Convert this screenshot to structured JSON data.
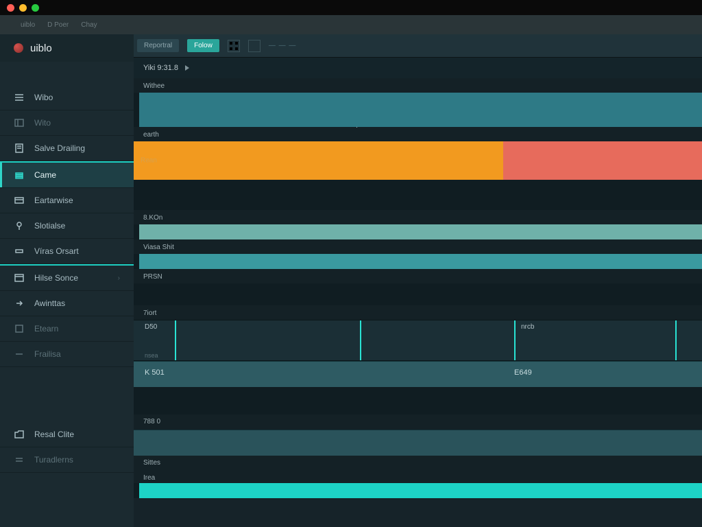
{
  "window": {
    "app_menu": "uiblo",
    "tab1": "D Poer",
    "tab2": "Chay"
  },
  "toolbar": {
    "btn1": "Reportral",
    "btn2": "Folow",
    "hint": "— — —"
  },
  "brand": {
    "name": "uiblo"
  },
  "sidebar": {
    "items": [
      {
        "label": "Wibo"
      },
      {
        "label": "Wito"
      },
      {
        "label": "Salve Drailing"
      },
      {
        "label": "Came"
      },
      {
        "label": "Eartarwise"
      },
      {
        "label": "Slotialse"
      },
      {
        "label": "Víras Orsart"
      },
      {
        "label": "Hilse Sonce"
      },
      {
        "label": "Awinttas"
      },
      {
        "label": "Etearn"
      },
      {
        "label": "Frailisa"
      }
    ],
    "bottom": [
      {
        "label": "Resal Clite"
      },
      {
        "label": "Turadlerns"
      }
    ]
  },
  "main": {
    "heading": "Yiki  9:31.8",
    "tracks": {
      "t1_label": "Withee",
      "t2_label": "earth",
      "t2_clip_label": "Rean",
      "t3_label": "8.KOn",
      "t4_label": "Viasa Shit",
      "t5_label": "PRSN"
    },
    "timeline": {
      "label": "7iort",
      "tick1": "D50",
      "tick2": "nrcb",
      "bottom1": "nsea"
    },
    "values": {
      "v1": "K 501",
      "v2": "E649"
    },
    "bottom_labels": {
      "l1": "788 0",
      "l2": "Sittes",
      "l3": "Irea"
    }
  }
}
